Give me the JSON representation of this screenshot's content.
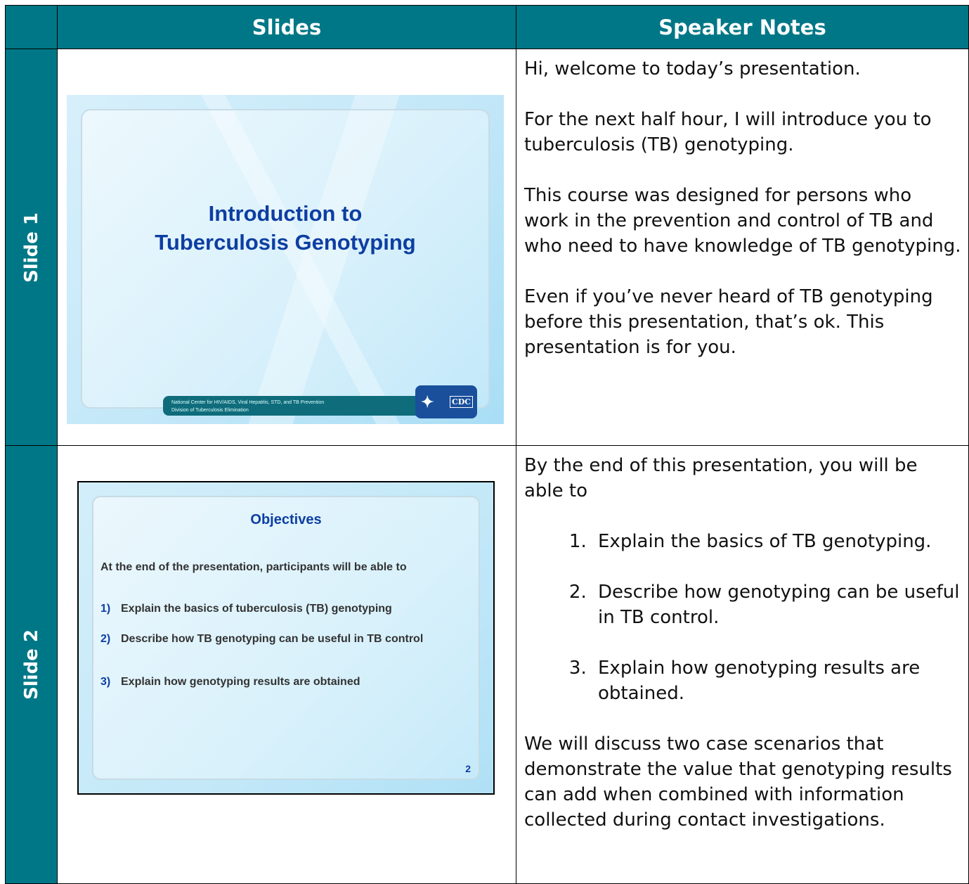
{
  "header": {
    "col_slides": "Slides",
    "col_notes": "Speaker Notes"
  },
  "rows": [
    {
      "label": "Slide 1",
      "slide": {
        "title_line1": "Introduction to",
        "title_line2": "Tuberculosis Genotyping",
        "footer_line1": "National Center for HIV/AIDS, Viral Hepatitis, STD, and TB Prevention",
        "footer_line2": "Division of Tuberculosis Elimination",
        "logo_text": "CDC"
      },
      "notes": [
        "Hi, welcome to today’s presentation.",
        "For the next half hour, I will introduce you to tuberculosis (TB) genotyping.",
        "This course was designed for persons who work in the prevention and control of TB and who need to have knowledge of TB genotyping.",
        "Even if you’ve never heard of TB genotyping before this presentation, that’s ok. This presentation is for you."
      ]
    },
    {
      "label": "Slide 2",
      "slide": {
        "title": "Objectives",
        "intro": "At the end of the presentation, participants will be able to",
        "items": [
          {
            "num": "1)",
            "text": "Explain the basics of tuberculosis (TB) genotyping"
          },
          {
            "num": "2)",
            "text": "Describe how TB genotyping can be useful in TB control"
          },
          {
            "num": "3)",
            "text": "Explain how genotyping results are obtained"
          }
        ],
        "page_number": "2"
      },
      "notes": {
        "intro": "By the end of this presentation, you will be able to",
        "list": [
          "Explain the basics of TB genotyping.",
          "Describe how genotyping can be useful in TB control.",
          "Explain how genotyping results are obtained."
        ],
        "closing": "We will discuss two case scenarios that demonstrate the value that genotyping results can add when combined with information collected during contact investigations."
      }
    }
  ]
}
